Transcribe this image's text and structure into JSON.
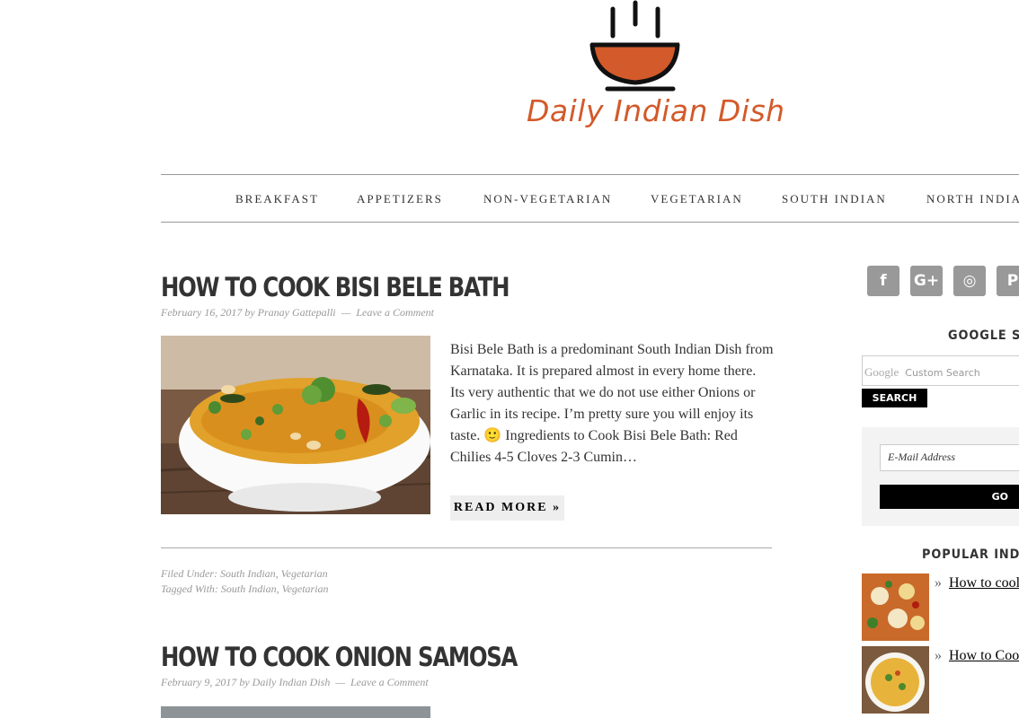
{
  "site": {
    "title": "Daily Indian Dish"
  },
  "nav": {
    "items": [
      "BREAKFAST",
      "APPETIZERS",
      "NON-VEGETARIAN",
      "VEGETARIAN",
      "SOUTH INDIAN",
      "NORTH INDIAN"
    ]
  },
  "posts": [
    {
      "title": "HOW TO COOK BISI BELE BATH",
      "date": "February 16, 2017",
      "by": "by",
      "author": "Pranay Gattepalli",
      "sep": "—",
      "comment": "Leave a Comment",
      "excerpt": "Bisi Bele Bath is a predominant South Indian Dish from Karnataka. It is prepared almost in every home there. Its very authentic that we do not use either Onions or Garlic in its recipe. I’m pretty sure you will enjoy its taste. 🙂 Ingredients to Cook Bisi Bele Bath: Red Chilies 4-5 Cloves 2-3 Cumin…",
      "read_more": "READ MORE »",
      "filed_label": "Filed Under:",
      "filed": "South Indian, Vegetarian",
      "tagged_label": "Tagged With:",
      "tagged": "South Indian, Vegetarian"
    },
    {
      "title": "HOW TO COOK ONION SAMOSA",
      "date": "February 9, 2017",
      "by": "by",
      "author": "Daily Indian Dish",
      "sep": "—",
      "comment": "Leave a Comment"
    }
  ],
  "sidebar": {
    "social": [
      "f",
      "G+",
      "◎",
      "P"
    ],
    "google_search_title": "GOOGLE SEA",
    "google_logo": "Google",
    "google_placeholder": "Custom Search",
    "search_button": "SEARCH",
    "email_placeholder": "E-Mail Address",
    "go_button": "GO",
    "popular_title": "POPULAR INDIAN",
    "popular": [
      {
        "label": "How to cool"
      },
      {
        "label": "How to Coo"
      }
    ]
  },
  "colors": {
    "brand": "#d35a2a",
    "social_bg": "#999999"
  }
}
